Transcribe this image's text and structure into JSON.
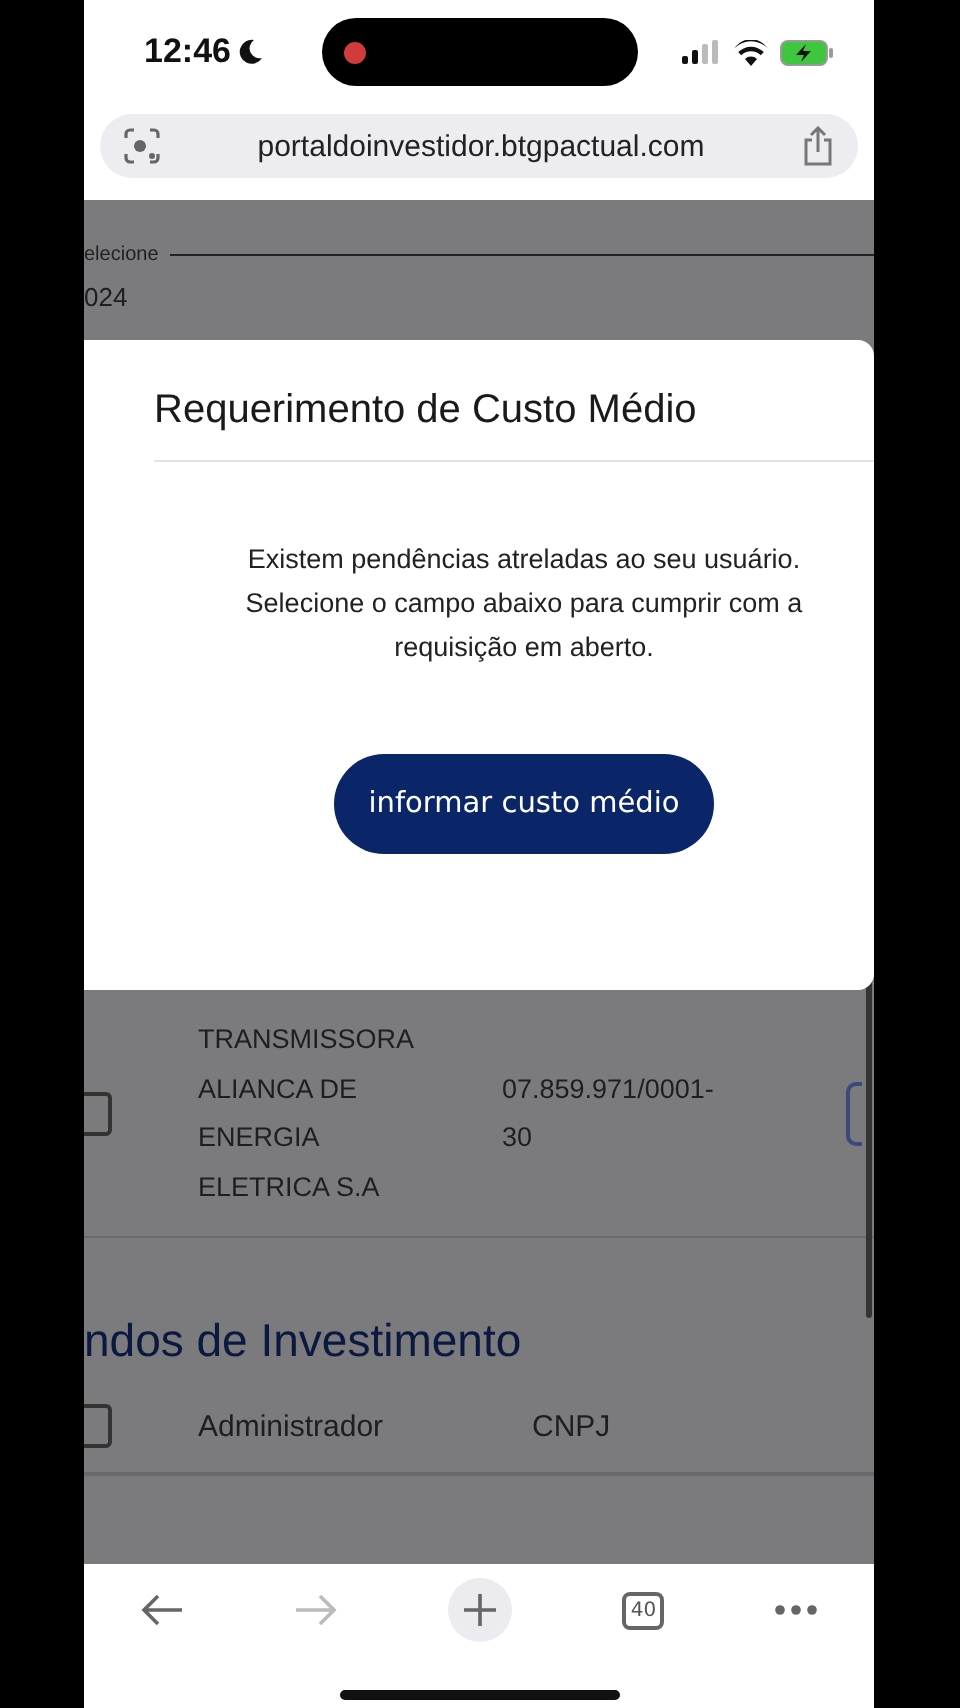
{
  "status_bar": {
    "time": "12:46"
  },
  "url_bar": {
    "url": "portaldoinvestidor.btgpactual.com"
  },
  "page": {
    "field_label": "elecione",
    "field_value": "024",
    "company_row": {
      "checked": false,
      "name": "TRANSMISSORA ALIANCA DE ENERGIA ELETRICA S.A",
      "cnpj": "07.859.971/0001-30"
    },
    "section_title": "ndos de Investimento",
    "header_row": {
      "checked": false,
      "columns": [
        "Administrador",
        "CNPJ"
      ]
    }
  },
  "modal": {
    "title": "Requerimento de Custo Médio",
    "message": "Existem pendências atreladas ao seu usuário. Selecione o campo abaixo para cumprir com a requisição em aberto.",
    "button": "informar custo médio"
  },
  "toolbar": {
    "tab_count": "40"
  }
}
